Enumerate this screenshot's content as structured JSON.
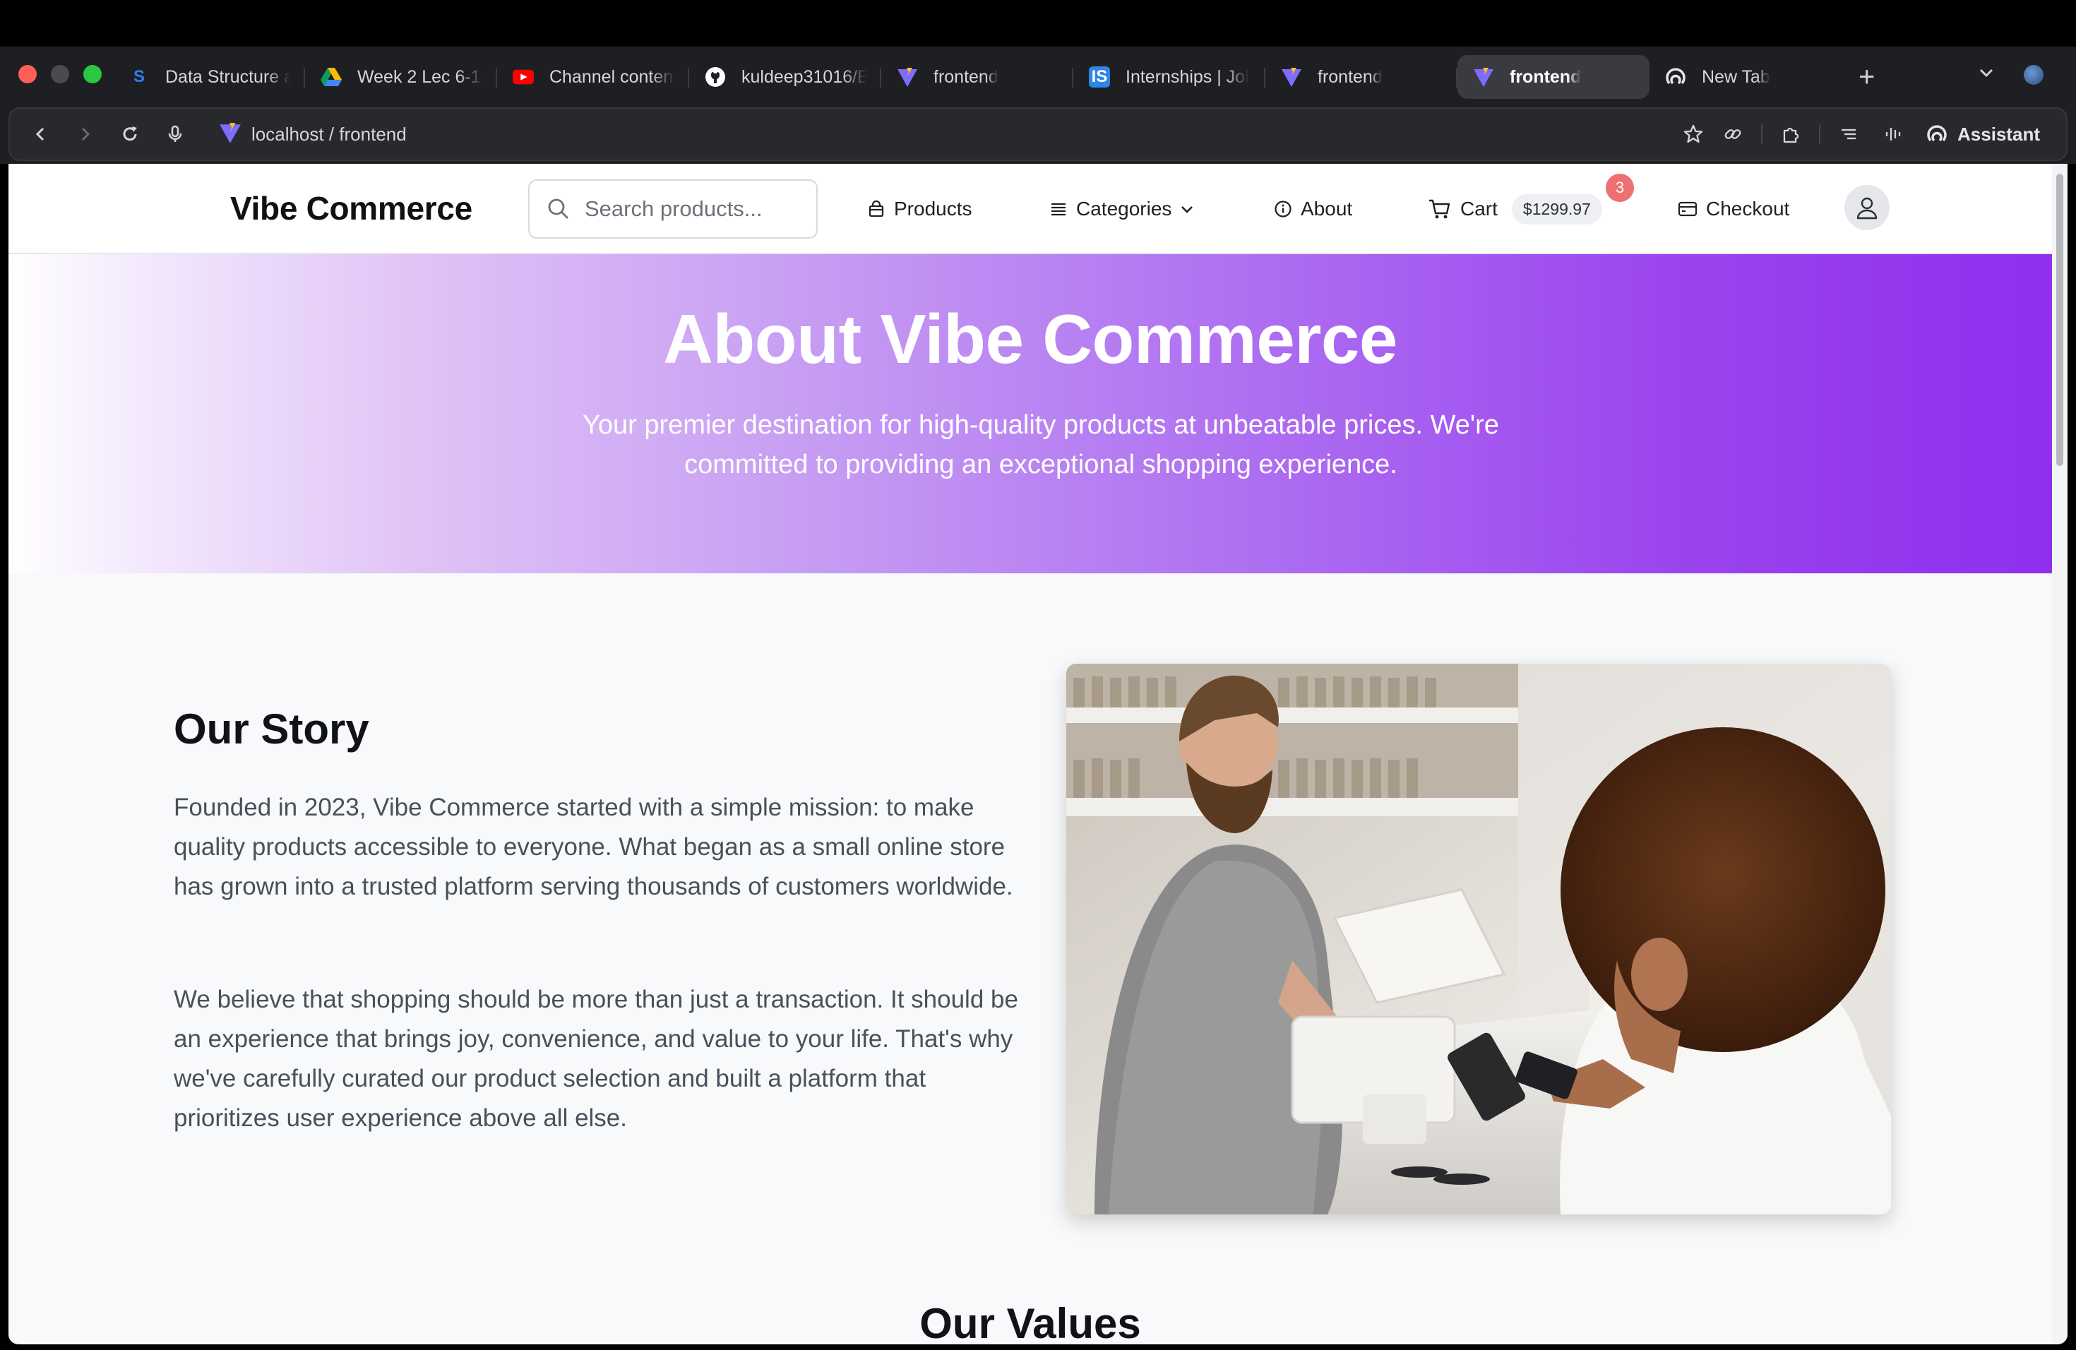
{
  "browser": {
    "tabs": [
      {
        "label": "Data Structure a",
        "icon": "s-logo-icon",
        "active": false
      },
      {
        "label": "Week 2 Lec 6-1(",
        "icon": "google-drive-icon",
        "active": false
      },
      {
        "label": "Channel content",
        "icon": "youtube-icon",
        "active": false
      },
      {
        "label": "kuldeep31016/E",
        "icon": "github-icon",
        "active": false
      },
      {
        "label": "frontend",
        "icon": "vite-icon",
        "active": false
      },
      {
        "label": "Internships | Jol",
        "icon": "internshala-icon",
        "active": false
      },
      {
        "label": "frontend",
        "icon": "vite-icon",
        "active": false
      },
      {
        "label": "frontend",
        "icon": "vite-icon",
        "active": true
      },
      {
        "label": "New Tab",
        "icon": "assistant-icon",
        "active": false
      }
    ],
    "url": "localhost / frontend",
    "assistant_label": "Assistant",
    "is_badge": "IS"
  },
  "nav": {
    "brand": "Vibe Commerce",
    "search_placeholder": "Search products...",
    "products": "Products",
    "categories": "Categories",
    "about": "About",
    "cart": "Cart",
    "cart_total": "$1299.97",
    "cart_count": "3",
    "checkout": "Checkout"
  },
  "hero": {
    "title": "About Vibe Commerce",
    "subtitle": "Your premier destination for high-quality products at unbeatable prices. We're committed to providing an exceptional shopping experience."
  },
  "story": {
    "title": "Our Story",
    "paragraph1": "Founded in 2023, Vibe Commerce started with a simple mission: to make quality products accessible to everyone. What began as a small online store has grown into a trusted platform serving thousands of customers worldwide.",
    "paragraph2": "We believe that shopping should be more than just a transaction. It should be an experience that brings joy, convenience, and value to your life. That's why we've carefully curated our product selection and built a platform that prioritizes user experience above all else."
  },
  "values": {
    "title": "Our Values"
  },
  "colors": {
    "accent": "#8f2fee",
    "badge": "#ef7070",
    "chrome": "#1e1f22"
  }
}
